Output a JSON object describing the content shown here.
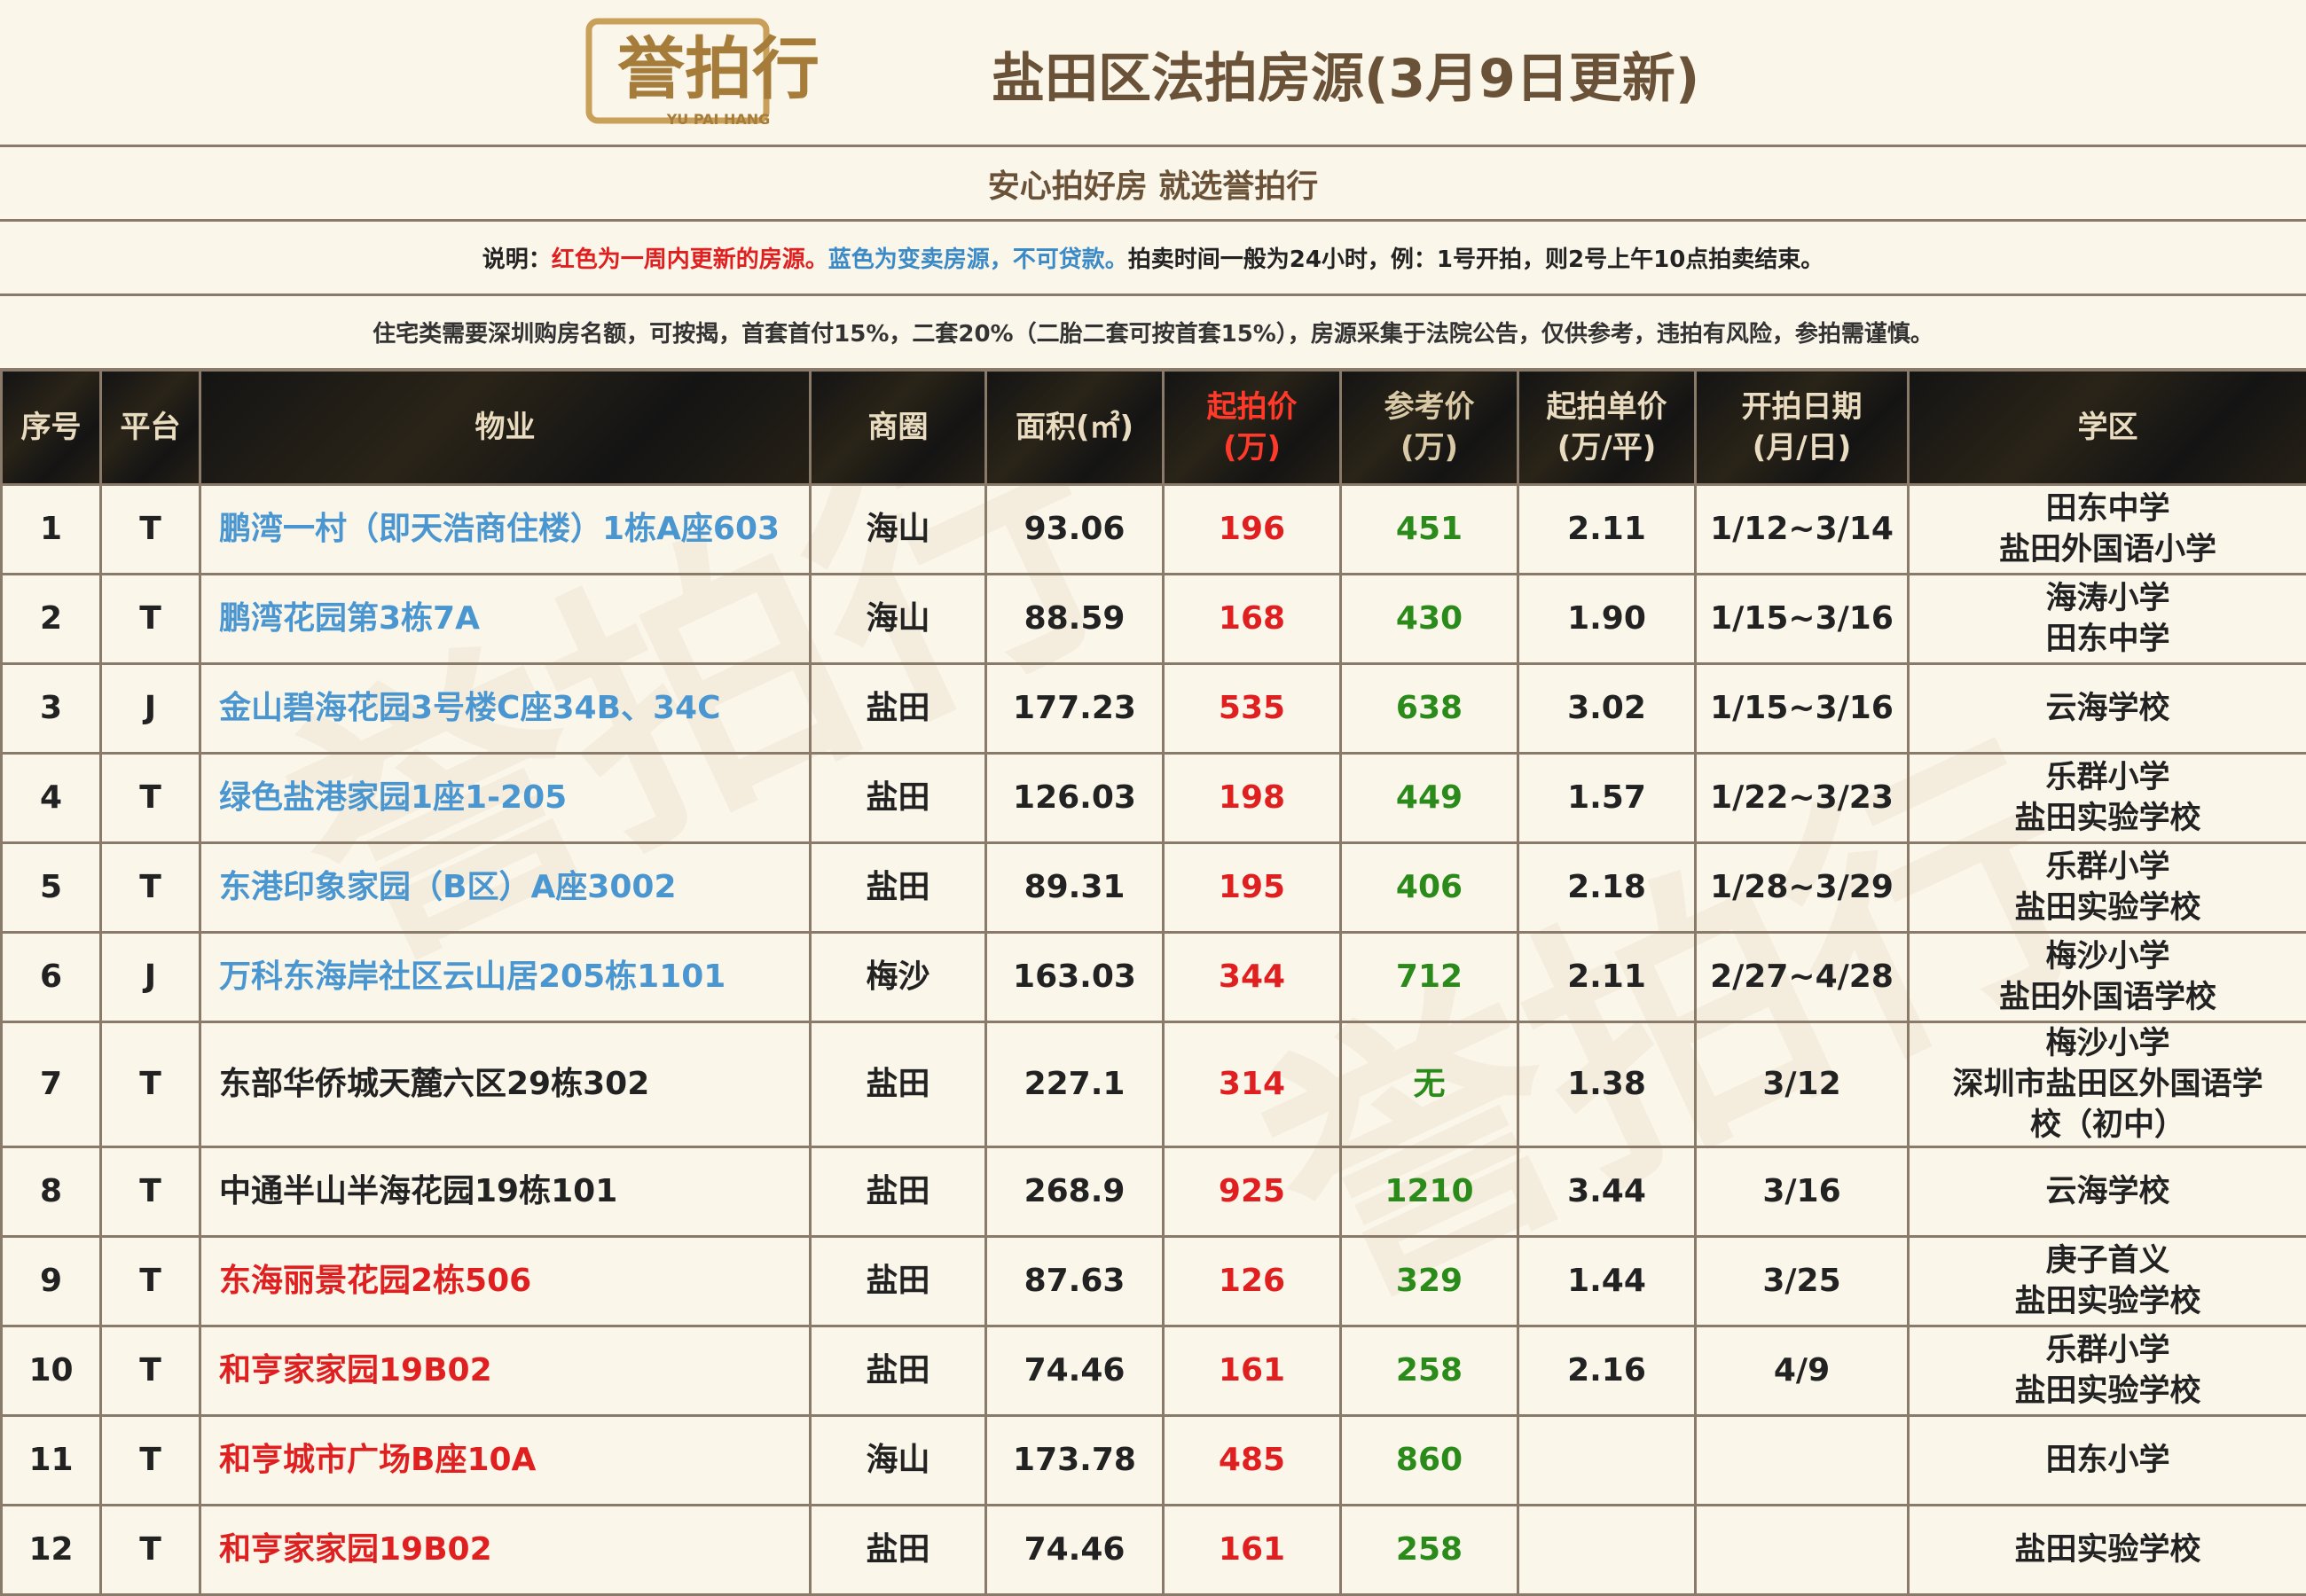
{
  "logo": {
    "brand": "誉拍行",
    "brand_pinyin": "YU PAI HANG"
  },
  "title": "盐田区法拍房源(3月9日更新)",
  "slogan": "安心拍好房 就选誉拍行",
  "note": {
    "prefix": "说明：",
    "red_text": "红色为一周内更新的房源。",
    "blue_text": "蓝色为变卖房源，不可贷款。",
    "rest": "拍卖时间一般为24小时，例：1号开拍，则2号上午10点拍卖结束。"
  },
  "rule": "住宅类需要深圳购房名额，可按揭，首套首付15%，二套20%（二胎二套可按首套15%），房源采集于法院公告，仅供参考，违拍有风险，参拍需谨慎。",
  "columns": {
    "no": "序号",
    "platform": "平台",
    "property": "物业",
    "district": "商圈",
    "area": "面积(㎡)",
    "start_price": [
      "起拍价",
      "(万)"
    ],
    "ref_price": [
      "参考价",
      "(万)"
    ],
    "unit_price": [
      "起拍单价",
      "(万/平)"
    ],
    "date": [
      "开拍日期",
      "(月/日)"
    ],
    "school": "学区"
  },
  "rows": [
    {
      "no": "1",
      "platform": "T",
      "property": "鹏湾一村（即天浩商住楼）1栋A座603",
      "color": "blue",
      "district": "海山",
      "area": "93.06",
      "start": "196",
      "ref": "451",
      "unit": "2.11",
      "date": "1/12~3/14",
      "schools": [
        "田东中学",
        "盐田外国语小学"
      ]
    },
    {
      "no": "2",
      "platform": "T",
      "property": "鹏湾花园第3栋7A",
      "color": "blue",
      "district": "海山",
      "area": "88.59",
      "start": "168",
      "ref": "430",
      "unit": "1.90",
      "date": "1/15~3/16",
      "schools": [
        "海涛小学",
        "田东中学"
      ]
    },
    {
      "no": "3",
      "platform": "J",
      "property": "金山碧海花园3号楼C座34B、34C",
      "color": "blue",
      "district": "盐田",
      "area": "177.23",
      "start": "535",
      "ref": "638",
      "unit": "3.02",
      "date": "1/15~3/16",
      "schools": [
        "云海学校"
      ]
    },
    {
      "no": "4",
      "platform": "T",
      "property": "绿色盐港家园1座1-205",
      "color": "blue",
      "district": "盐田",
      "area": "126.03",
      "start": "198",
      "ref": "449",
      "unit": "1.57",
      "date": "1/22~3/23",
      "schools": [
        "乐群小学",
        "盐田实验学校"
      ]
    },
    {
      "no": "5",
      "platform": "T",
      "property": "东港印象家园（B区）A座3002",
      "color": "blue",
      "district": "盐田",
      "area": "89.31",
      "start": "195",
      "ref": "406",
      "unit": "2.18",
      "date": "1/28~3/29",
      "schools": [
        "乐群小学",
        "盐田实验学校"
      ]
    },
    {
      "no": "6",
      "platform": "J",
      "property": "万科东海岸社区云山居205栋1101",
      "color": "blue",
      "district": "梅沙",
      "area": "163.03",
      "start": "344",
      "ref": "712",
      "unit": "2.11",
      "date": "2/27~4/28",
      "schools": [
        "梅沙小学",
        "盐田外国语学校"
      ]
    },
    {
      "no": "7",
      "platform": "T",
      "property": "东部华侨城天麓六区29栋302",
      "color": "black",
      "district": "盐田",
      "area": "227.1",
      "start": "314",
      "ref": "无",
      "unit": "1.38",
      "date": "3/12",
      "schools": [
        "梅沙小学",
        "深圳市盐田区外国语学",
        "校（初中）"
      ],
      "tall": true
    },
    {
      "no": "8",
      "platform": "T",
      "property": "中通半山半海花园19栋101",
      "color": "black",
      "district": "盐田",
      "area": "268.9",
      "start": "925",
      "ref": "1210",
      "unit": "3.44",
      "date": "3/16",
      "schools": [
        "云海学校"
      ]
    },
    {
      "no": "9",
      "platform": "T",
      "property": "东海丽景花园2栋506",
      "color": "red",
      "district": "盐田",
      "area": "87.63",
      "start": "126",
      "ref": "329",
      "unit": "1.44",
      "date": "3/25",
      "schools": [
        "庚子首义",
        "盐田实验学校"
      ]
    },
    {
      "no": "10",
      "platform": "T",
      "property": "和亨家家园19B02",
      "color": "red",
      "district": "盐田",
      "area": "74.46",
      "start": "161",
      "ref": "258",
      "unit": "2.16",
      "date": "4/9",
      "schools": [
        "乐群小学",
        "盐田实验学校"
      ]
    },
    {
      "no": "11",
      "platform": "T",
      "property": "和亨城市广场B座10A",
      "color": "red",
      "district": "海山",
      "area": "173.78",
      "start": "485",
      "ref": "860",
      "unit": "",
      "date": "",
      "schools": [
        "田东小学"
      ]
    },
    {
      "no": "12",
      "platform": "T",
      "property": "和亨家家园19B02",
      "color": "red",
      "district": "盐田",
      "area": "74.46",
      "start": "161",
      "ref": "258",
      "unit": "",
      "date": "",
      "schools": [
        "盐田实验学校"
      ]
    }
  ]
}
